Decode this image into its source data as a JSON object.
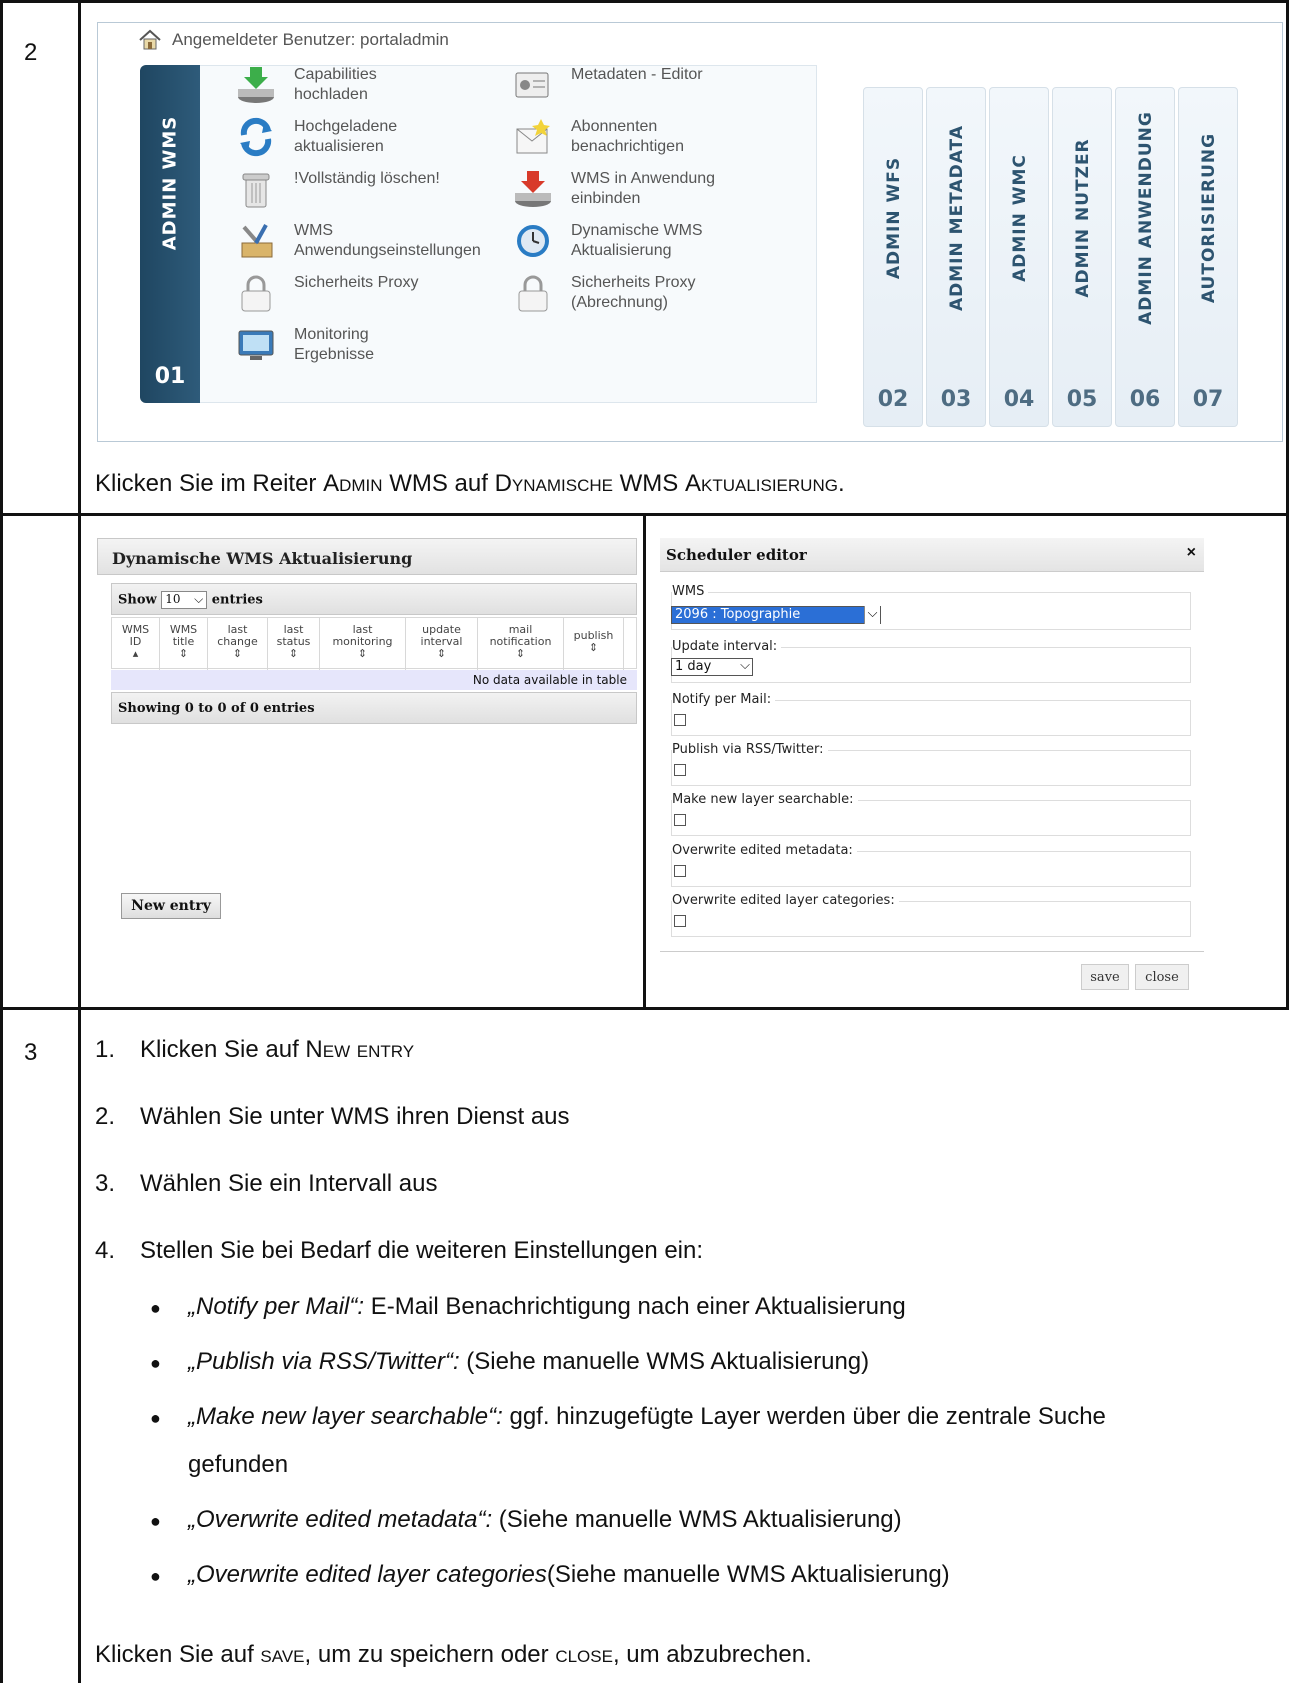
{
  "row2": {
    "step_number": "2",
    "user_label": "Angemeldeter Benutzer: portaladmin",
    "active_tab": {
      "label": "ADMIN WMS",
      "number": "01"
    },
    "menu_left": [
      {
        "label": "Capabilities\nhochladen",
        "icon": "download-server-icon"
      },
      {
        "label": "Hochgeladene\naktualisieren",
        "icon": "refresh-icon"
      },
      {
        "label": "!Vollständig löschen!",
        "icon": "trash-icon"
      },
      {
        "label": "WMS\nAnwendungseinstellungen",
        "icon": "tools-icon"
      },
      {
        "label": "Sicherheits Proxy",
        "icon": "lock-icon"
      },
      {
        "label": "Monitoring\nErgebnisse",
        "icon": "monitor-icon"
      }
    ],
    "menu_right": [
      {
        "label": "Metadaten - Editor",
        "icon": "id-card-icon"
      },
      {
        "label": "Abonnenten\nbenachrichtigen",
        "icon": "envelope-star-icon"
      },
      {
        "label": "WMS in Anwendung\neinbinden",
        "icon": "insert-server-icon"
      },
      {
        "label": "Dynamische WMS\nAktualisierung",
        "icon": "clock-refresh-icon"
      },
      {
        "label": "Sicherheits Proxy\n(Abrechnung)",
        "icon": "lock-icon"
      }
    ],
    "tabs": [
      {
        "label": "ADMIN WFS",
        "number": "02"
      },
      {
        "label": "ADMIN METADATA",
        "number": "03"
      },
      {
        "label": "ADMIN WMC",
        "number": "04"
      },
      {
        "label": "ADMIN NUTZER",
        "number": "05"
      },
      {
        "label": "ADMIN ANWENDUNG",
        "number": "06"
      },
      {
        "label": "AUTORISIERUNG",
        "number": "07"
      }
    ],
    "instruction": {
      "part1": "Klicken Sie im Reiter ",
      "sc1": "Admin",
      "part2": " WMS auf ",
      "sc2": "Dynamische",
      "part3": " WMS ",
      "sc3": "Aktualisierung",
      "part4": "."
    }
  },
  "list_panel": {
    "title": "Dynamische WMS Aktualisierung",
    "show_label": "Show",
    "show_value": "10",
    "entries_label": "entries",
    "columns": [
      "WMS\nID",
      "WMS\ntitle",
      "last\nchange",
      "last\nstatus",
      "last\nmonitoring",
      "update\ninterval",
      "mail\nnotification",
      "publish"
    ],
    "empty_message": "No data available in table",
    "footer": "Showing 0 to 0 of 0 entries",
    "new_entry_button": "New entry"
  },
  "scheduler": {
    "title": "Scheduler editor",
    "close_x": "×",
    "wms_label": "WMS",
    "wms_value": "2096 : Topographie",
    "interval_label": "Update interval:",
    "interval_value": "1 day",
    "checkboxes": [
      "Notify per Mail:",
      "Publish via RSS/Twitter:",
      "Make new layer searchable:",
      "Overwrite edited metadata:",
      "Overwrite edited layer categories:"
    ],
    "save_button": "save",
    "close_button": "close"
  },
  "row3": {
    "step_number": "3",
    "steps": [
      {
        "num": "1.",
        "text": "Klicken Sie auf ",
        "sc": "New entry"
      },
      {
        "num": "2.",
        "text": "Wählen Sie unter WMS ihren Dienst aus"
      },
      {
        "num": "3.",
        "text": "Wählen Sie ein Intervall aus"
      },
      {
        "num": "4.",
        "text": "Stellen Sie bei Bedarf die weiteren Einstellungen ein:"
      }
    ],
    "bullets": [
      {
        "italic": "„Notify per Mail“:",
        "text": " E-Mail Benachrichtigung nach einer Aktualisierung"
      },
      {
        "italic": "„Publish via RSS/Twitter“:",
        "text": " (Siehe manuelle WMS Aktualisierung)"
      },
      {
        "italic": "„Make new layer searchable“:",
        "text": " ggf. hinzugefügte Layer werden über die zentrale Suche",
        "text2": "gefunden"
      },
      {
        "italic": "„Overwrite edited metadata“:",
        "text": " (Siehe manuelle WMS Aktualisierung)"
      },
      {
        "italic": "„Overwrite edited layer categories",
        "text": "(Siehe manuelle WMS Aktualisierung)"
      }
    ],
    "final": {
      "part1": "Klicken Sie auf ",
      "sc1": "save",
      "part2": ", um zu speichern oder ",
      "sc2": "close",
      "part3": ", um abzubrechen."
    }
  }
}
